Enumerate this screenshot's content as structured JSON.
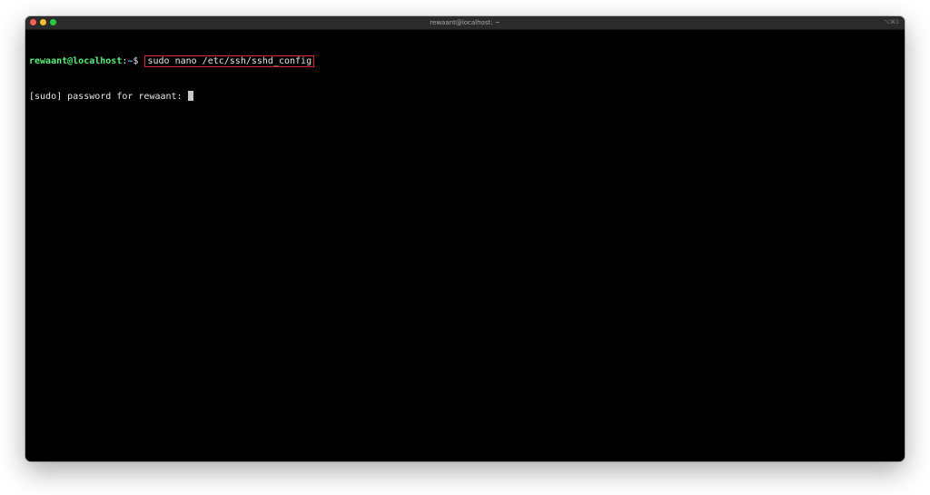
{
  "window": {
    "title": "rewaant@localhost: ~",
    "shortcut": "⌥⌘1"
  },
  "terminal": {
    "prompt": {
      "user_host": "rewaant@localhost",
      "separator": ":",
      "path": "~",
      "symbol": "$ "
    },
    "command": "sudo nano /etc/ssh/sshd_config",
    "output_line": "[sudo] password for rewaant: "
  },
  "colors": {
    "prompt_user": "#58f07a",
    "prompt_path": "#7aa9ff",
    "highlight_box": "#d92a2a",
    "background": "#000000"
  }
}
